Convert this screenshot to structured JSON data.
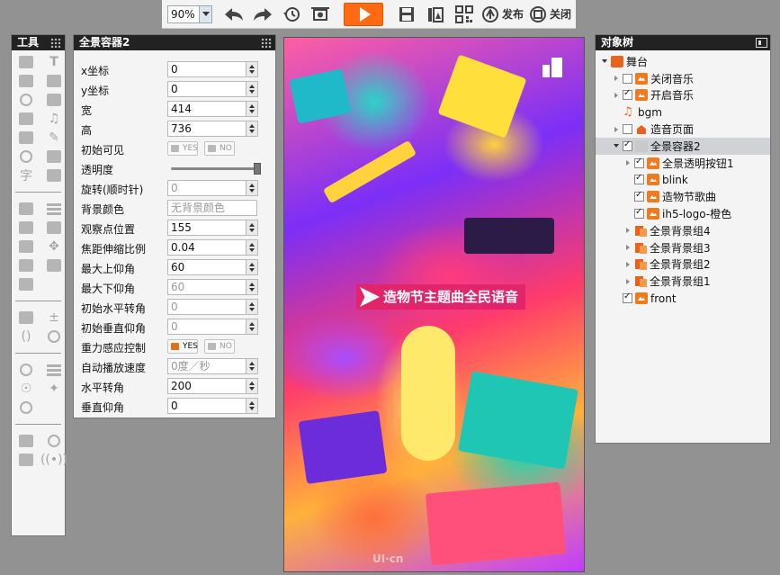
{
  "toolbar": {
    "zoom_value": "90%",
    "publish_label": "发布",
    "close_label": "关闭",
    "icons": [
      "undo-icon",
      "redo-icon",
      "history-icon",
      "screenshot-icon",
      "play-icon",
      "save-icon",
      "scene-icon",
      "qrcode-icon",
      "publish-icon",
      "close-icon"
    ],
    "accent": "#ff6a13"
  },
  "tools": {
    "title": "工具"
  },
  "props": {
    "title": "全景容器2",
    "rows": [
      {
        "label": "x坐标",
        "value": "0"
      },
      {
        "label": "y坐标",
        "value": "0"
      },
      {
        "label": "宽",
        "value": "414"
      },
      {
        "label": "高",
        "value": "736"
      },
      {
        "label": "初始可见",
        "yes": "YES",
        "no": "NO"
      },
      {
        "label": "透明度",
        "level": 1.0
      },
      {
        "label": "旋转(顺时针)",
        "value": "0"
      },
      {
        "label": "背景颜色",
        "value": "无背景颜色"
      },
      {
        "label": "观察点位置",
        "value": "155"
      },
      {
        "label": "焦距伸缩比例",
        "value": "0.04"
      },
      {
        "label": "最大上仰角",
        "value": "60"
      },
      {
        "label": "最大下仰角",
        "value": "60"
      },
      {
        "label": "初始水平转角",
        "value": "0"
      },
      {
        "label": "初始垂直仰角",
        "value": "0"
      },
      {
        "label": "重力感应控制",
        "yes": "YES",
        "no": "NO"
      },
      {
        "label": "自动播放速度",
        "value": "0度／秒"
      },
      {
        "label": "水平转角",
        "value": "200"
      },
      {
        "label": "垂直仰角",
        "value": "0"
      }
    ]
  },
  "stage": {
    "banner_text": "造物节主题曲全民语音",
    "watermark": "UI·cn"
  },
  "tree": {
    "title": "对象树",
    "nodes": [
      {
        "label": "舞台",
        "depth": 0,
        "twisty": "open",
        "check": "none",
        "icon": "stage"
      },
      {
        "label": "关闭音乐",
        "depth": 1,
        "twisty": "closed",
        "check": "off",
        "icon": "img"
      },
      {
        "label": "开启音乐",
        "depth": 1,
        "twisty": "closed",
        "check": "on",
        "icon": "img"
      },
      {
        "label": "bgm",
        "depth": 1,
        "twisty": "none",
        "check": "none",
        "icon": "music"
      },
      {
        "label": "造音页面",
        "depth": 1,
        "twisty": "closed",
        "check": "off",
        "icon": "page"
      },
      {
        "label": "全景容器2",
        "depth": 1,
        "twisty": "open",
        "check": "on",
        "icon": "pano",
        "selected": true
      },
      {
        "label": "全景透明按钮1",
        "depth": 2,
        "twisty": "closed",
        "check": "on",
        "icon": "img"
      },
      {
        "label": "blink",
        "depth": 2,
        "twisty": "none",
        "check": "on",
        "icon": "img"
      },
      {
        "label": "造物节歌曲",
        "depth": 2,
        "twisty": "none",
        "check": "on",
        "icon": "img"
      },
      {
        "label": "ih5-logo-橙色",
        "depth": 2,
        "twisty": "none",
        "check": "on",
        "icon": "img"
      },
      {
        "label": "全景背景组4",
        "depth": 2,
        "twisty": "closed",
        "check": "none",
        "icon": "grp"
      },
      {
        "label": "全景背景组3",
        "depth": 2,
        "twisty": "closed",
        "check": "none",
        "icon": "grp"
      },
      {
        "label": "全景背景组2",
        "depth": 2,
        "twisty": "closed",
        "check": "none",
        "icon": "grp"
      },
      {
        "label": "全景背景组1",
        "depth": 2,
        "twisty": "closed",
        "check": "none",
        "icon": "grp"
      },
      {
        "label": "front",
        "depth": 1,
        "twisty": "none",
        "check": "on",
        "icon": "img"
      }
    ]
  }
}
